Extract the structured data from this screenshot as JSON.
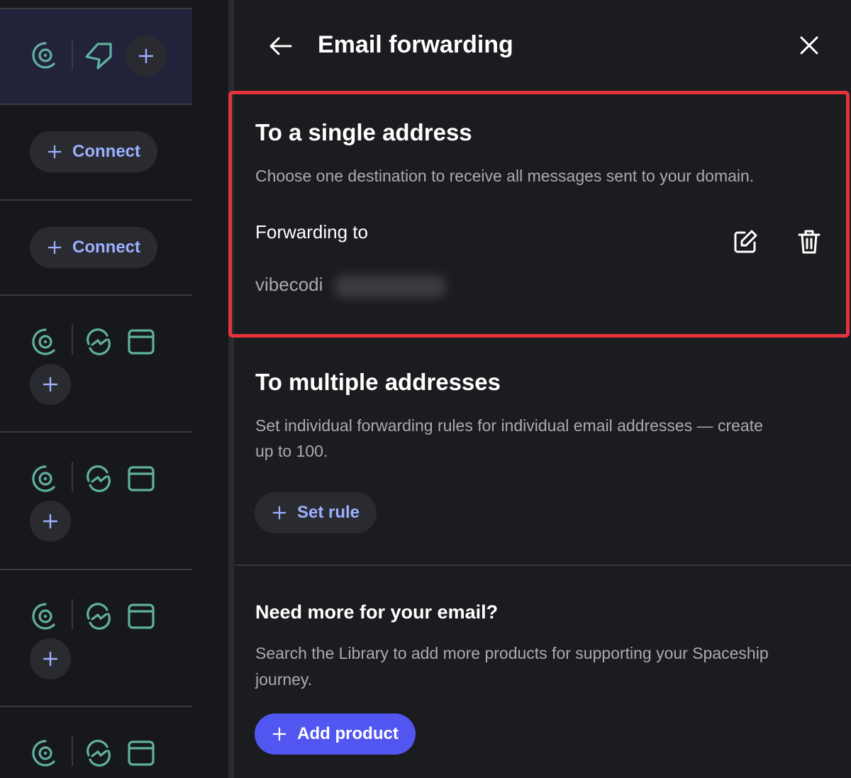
{
  "sidebar": {
    "connect_label": "Connect",
    "colors": {
      "teal": "#5fb0a0",
      "accent": "#9bb0ff"
    },
    "icons": [
      "target-icon",
      "tag-icon",
      "sync-icon",
      "browser-window-icon",
      "plus-icon"
    ]
  },
  "panel": {
    "title": "Email forwarding",
    "single": {
      "heading": "To a single address",
      "description": "Choose one destination to receive all messages sent to your domain.",
      "forwarding_label": "Forwarding to",
      "forwarding_value": "vibecodi"
    },
    "multiple": {
      "heading": "To multiple addresses",
      "description_line1": "Set individual forwarding rules for individual email addresses — create",
      "description_line2": "up to 100.",
      "button_label": "Set rule"
    },
    "more": {
      "heading": "Need more for your email?",
      "description_line1": "Search the Library to add more products for supporting your Spaceship",
      "description_line2": "journey.",
      "button_label": "Add product"
    },
    "colors": {
      "highlight": "#e5333d",
      "primary_button": "#5156f0"
    }
  }
}
